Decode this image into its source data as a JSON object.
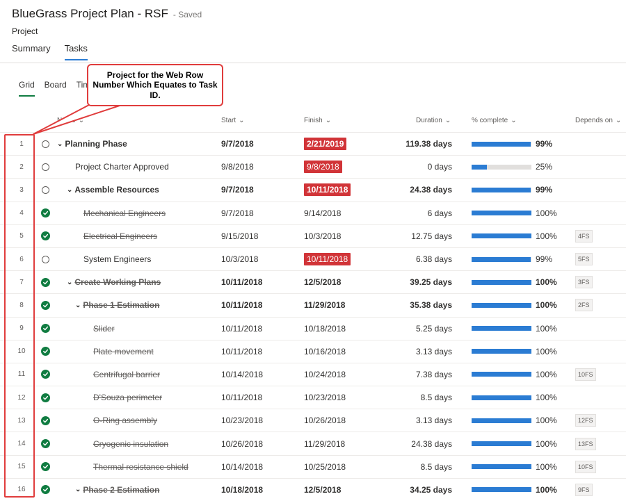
{
  "header": {
    "title": "BlueGrass Project Plan - RSF",
    "saved": "- Saved",
    "subtitle": "Project"
  },
  "tabs": [
    {
      "label": "Summary",
      "active": false
    },
    {
      "label": "Tasks",
      "active": true
    }
  ],
  "views": [
    {
      "label": "Grid",
      "active": true
    },
    {
      "label": "Board",
      "active": false
    },
    {
      "label": "Tim",
      "active": false
    }
  ],
  "columns": {
    "name": "Name",
    "start": "Start",
    "finish": "Finish",
    "duration": "Duration",
    "percent": "% complete",
    "depends": "Depends on"
  },
  "callout": {
    "text": "Project for the Web Row Number Which Equates to Task ID."
  },
  "colors": {
    "accent": "#2b7cd3",
    "done": "#107c41",
    "late": "#d13438",
    "annotation": "#e03c3c"
  },
  "rows": [
    {
      "num": "1",
      "done": false,
      "bold": true,
      "indent": 0,
      "caret": true,
      "name": "Planning Phase",
      "start": "9/7/2018",
      "finish": "2/21/2019",
      "late": true,
      "duration": "119.38 days",
      "pct": 99,
      "pct_label": "99%",
      "dep": ""
    },
    {
      "num": "2",
      "done": false,
      "bold": false,
      "indent": 1,
      "caret": false,
      "name": "Project Charter Approved",
      "start": "9/8/2018",
      "finish": "9/8/2018",
      "late": true,
      "duration": "0 days",
      "pct": 25,
      "pct_label": "25%",
      "dep": ""
    },
    {
      "num": "3",
      "done": false,
      "bold": true,
      "indent": 1,
      "caret": true,
      "name": "Assemble Resources",
      "start": "9/7/2018",
      "finish": "10/11/2018",
      "late": true,
      "duration": "24.38 days",
      "pct": 99,
      "pct_label": "99%",
      "dep": ""
    },
    {
      "num": "4",
      "done": true,
      "bold": false,
      "indent": 2,
      "caret": false,
      "name": "Mechanical Engineers",
      "start": "9/7/2018",
      "finish": "9/14/2018",
      "late": false,
      "duration": "6 days",
      "pct": 100,
      "pct_label": "100%",
      "dep": ""
    },
    {
      "num": "5",
      "done": true,
      "bold": false,
      "indent": 2,
      "caret": false,
      "name": "Electrical Engineers",
      "start": "9/15/2018",
      "finish": "10/3/2018",
      "late": false,
      "duration": "12.75 days",
      "pct": 100,
      "pct_label": "100%",
      "dep": "4FS"
    },
    {
      "num": "6",
      "done": false,
      "bold": false,
      "indent": 2,
      "caret": false,
      "name": "System Engineers",
      "start": "10/3/2018",
      "finish": "10/11/2018",
      "late": true,
      "duration": "6.38 days",
      "pct": 99,
      "pct_label": "99%",
      "dep": "5FS"
    },
    {
      "num": "7",
      "done": true,
      "bold": true,
      "indent": 1,
      "caret": true,
      "name": "Create Working Plans",
      "start": "10/11/2018",
      "finish": "12/5/2018",
      "late": false,
      "duration": "39.25 days",
      "pct": 100,
      "pct_label": "100%",
      "dep": "3FS"
    },
    {
      "num": "8",
      "done": true,
      "bold": true,
      "indent": 2,
      "caret": true,
      "name": "Phase 1 Estimation",
      "start": "10/11/2018",
      "finish": "11/29/2018",
      "late": false,
      "duration": "35.38 days",
      "pct": 100,
      "pct_label": "100%",
      "dep": "2FS"
    },
    {
      "num": "9",
      "done": true,
      "bold": false,
      "indent": 3,
      "caret": false,
      "name": "Slider",
      "start": "10/11/2018",
      "finish": "10/18/2018",
      "late": false,
      "duration": "5.25 days",
      "pct": 100,
      "pct_label": "100%",
      "dep": ""
    },
    {
      "num": "10",
      "done": true,
      "bold": false,
      "indent": 3,
      "caret": false,
      "name": "Plate movement",
      "start": "10/11/2018",
      "finish": "10/16/2018",
      "late": false,
      "duration": "3.13 days",
      "pct": 100,
      "pct_label": "100%",
      "dep": ""
    },
    {
      "num": "11",
      "done": true,
      "bold": false,
      "indent": 3,
      "caret": false,
      "name": "Centrifugal barrier",
      "start": "10/14/2018",
      "finish": "10/24/2018",
      "late": false,
      "duration": "7.38 days",
      "pct": 100,
      "pct_label": "100%",
      "dep": "10FS"
    },
    {
      "num": "12",
      "done": true,
      "bold": false,
      "indent": 3,
      "caret": false,
      "name": "D'Souza perimeter",
      "start": "10/11/2018",
      "finish": "10/23/2018",
      "late": false,
      "duration": "8.5 days",
      "pct": 100,
      "pct_label": "100%",
      "dep": ""
    },
    {
      "num": "13",
      "done": true,
      "bold": false,
      "indent": 3,
      "caret": false,
      "name": "O-Ring assembly",
      "start": "10/23/2018",
      "finish": "10/26/2018",
      "late": false,
      "duration": "3.13 days",
      "pct": 100,
      "pct_label": "100%",
      "dep": "12FS"
    },
    {
      "num": "14",
      "done": true,
      "bold": false,
      "indent": 3,
      "caret": false,
      "name": "Cryogenic insulation",
      "start": "10/26/2018",
      "finish": "11/29/2018",
      "late": false,
      "duration": "24.38 days",
      "pct": 100,
      "pct_label": "100%",
      "dep": "13FS"
    },
    {
      "num": "15",
      "done": true,
      "bold": false,
      "indent": 3,
      "caret": false,
      "name": "Thermal resistance shield",
      "start": "10/14/2018",
      "finish": "10/25/2018",
      "late": false,
      "duration": "8.5 days",
      "pct": 100,
      "pct_label": "100%",
      "dep": "10FS"
    },
    {
      "num": "16",
      "done": true,
      "bold": true,
      "indent": 2,
      "caret": true,
      "name": "Phase 2 Estimation",
      "start": "10/18/2018",
      "finish": "12/5/2018",
      "late": false,
      "duration": "34.25 days",
      "pct": 100,
      "pct_label": "100%",
      "dep": "9FS"
    }
  ]
}
